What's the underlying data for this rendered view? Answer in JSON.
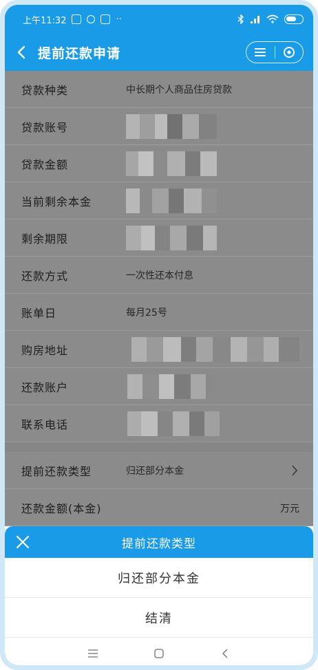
{
  "status": {
    "time": "上午11:32",
    "more": "··"
  },
  "header": {
    "title": "提前还款申请"
  },
  "rows": [
    {
      "label": "贷款种类",
      "value": "中长期个人商品住房贷款"
    },
    {
      "label": "贷款账号",
      "value": ""
    },
    {
      "label": "贷款金额",
      "value": ""
    },
    {
      "label": "当前剩余本金",
      "value": ""
    },
    {
      "label": "剩余期限",
      "value": ""
    },
    {
      "label": "还款方式",
      "value": "一次性还本付息"
    },
    {
      "label": "账单日",
      "value": "每月25号"
    },
    {
      "label": "购房地址",
      "value": ""
    },
    {
      "label": "还款账户",
      "value": ""
    },
    {
      "label": "联系电话",
      "value": ""
    }
  ],
  "prepay": {
    "type_label": "提前还款类型",
    "type_value": "归还部分本金",
    "amount_label": "还款金额(本金)",
    "amount_unit": "万元"
  },
  "sheet": {
    "title": "提前还款类型",
    "options": [
      "归还部分本金",
      "结清"
    ]
  },
  "colors": {
    "accent": "#1a9be8",
    "overlay": "#8f8f8f"
  }
}
